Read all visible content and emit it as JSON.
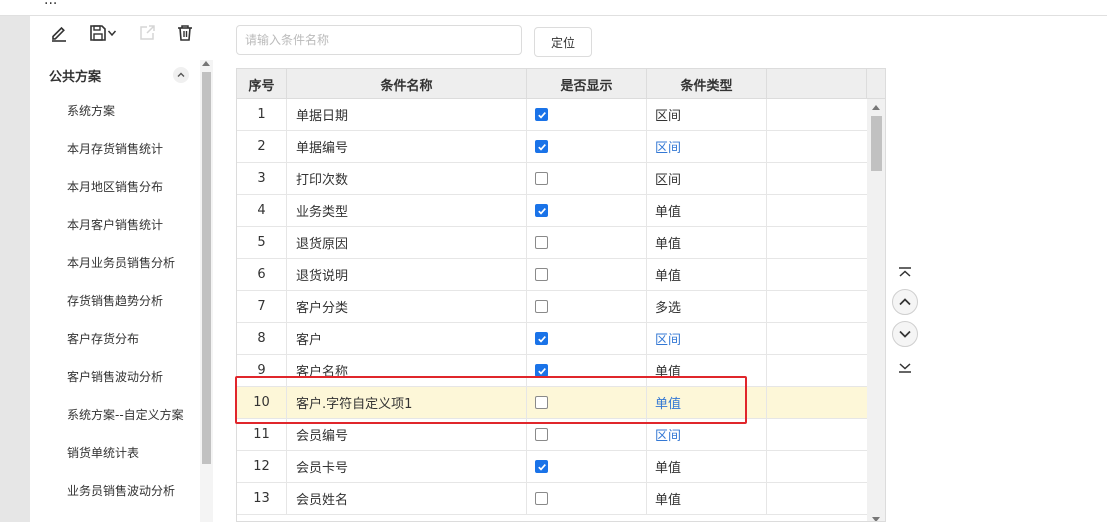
{
  "window": {
    "title": "..."
  },
  "toolbar": {
    "icons": [
      "edit-icon",
      "save-icon",
      "chevron-down-icon",
      "export-icon",
      "delete-icon"
    ]
  },
  "left_panel": {
    "group_title": "公共方案",
    "items": [
      "系统方案",
      "本月存货销售统计",
      "本月地区销售分布",
      "本月客户销售统计",
      "本月业务员销售分析",
      "存货销售趋势分析",
      "客户存货分布",
      "客户销售波动分析",
      "系统方案--自定义方案",
      "销货单统计表",
      "业务员销售波动分析"
    ]
  },
  "search": {
    "placeholder": "请输入条件名称",
    "value": ""
  },
  "locate_button": "定位",
  "grid": {
    "headers": [
      "序号",
      "条件名称",
      "是否显示",
      "条件类型",
      ""
    ],
    "rows": [
      {
        "no": "1",
        "name": "单据日期",
        "shown": true,
        "type": "区间",
        "type_link": false
      },
      {
        "no": "2",
        "name": "单据编号",
        "shown": true,
        "type": "区间",
        "type_link": true
      },
      {
        "no": "3",
        "name": "打印次数",
        "shown": false,
        "type": "区间",
        "type_link": false
      },
      {
        "no": "4",
        "name": "业务类型",
        "shown": true,
        "type": "单值",
        "type_link": false
      },
      {
        "no": "5",
        "name": "退货原因",
        "shown": false,
        "type": "单值",
        "type_link": false
      },
      {
        "no": "6",
        "name": "退货说明",
        "shown": false,
        "type": "单值",
        "type_link": false
      },
      {
        "no": "7",
        "name": "客户分类",
        "shown": false,
        "type": "多选",
        "type_link": false
      },
      {
        "no": "8",
        "name": "客户",
        "shown": true,
        "type": "区间",
        "type_link": true
      },
      {
        "no": "9",
        "name": "客户名称",
        "shown": true,
        "type": "单值",
        "type_link": false
      },
      {
        "no": "10",
        "name": "客户.字符自定义项1",
        "shown": false,
        "type": "单值",
        "type_link": true,
        "selected": true
      },
      {
        "no": "11",
        "name": "会员编号",
        "shown": false,
        "type": "区间",
        "type_link": true
      },
      {
        "no": "12",
        "name": "会员卡号",
        "shown": true,
        "type": "单值",
        "type_link": false
      },
      {
        "no": "13",
        "name": "会员姓名",
        "shown": false,
        "type": "单值",
        "type_link": false
      }
    ]
  },
  "move_buttons": [
    "move-top-icon",
    "move-up-icon",
    "move-down-icon",
    "move-bottom-icon"
  ],
  "colors": {
    "accent": "#1a73e8",
    "link": "#3478d4",
    "highlight_row": "#fdf7d8",
    "annotation": "#e0262b"
  }
}
